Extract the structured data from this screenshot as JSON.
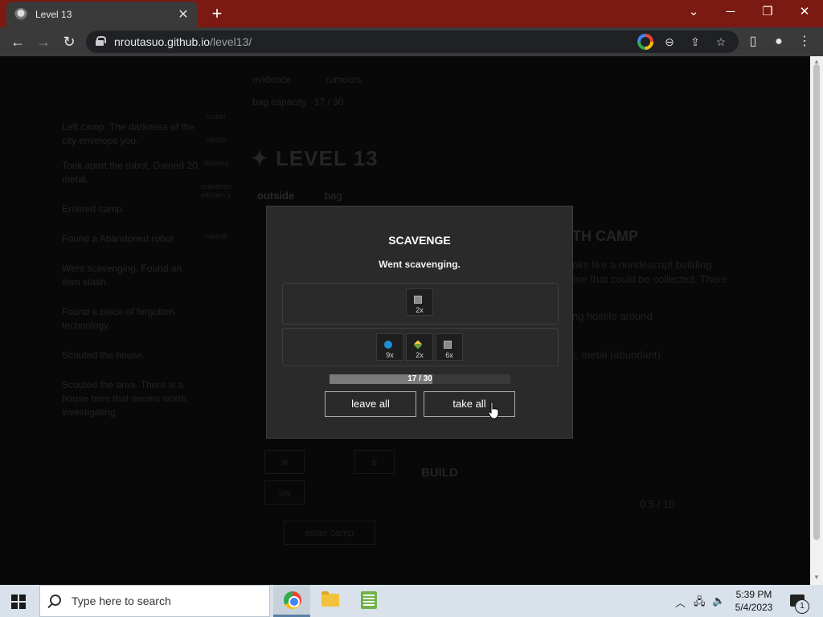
{
  "browser": {
    "tab_title": "Level 13",
    "tab_close": "✕",
    "new_tab": "+",
    "url_host": "nroutasuo.github.io",
    "url_path": "/level13/",
    "window_controls": {
      "minimize": "─",
      "restore": "❐",
      "close": "✕",
      "tabsearch": "⌄"
    }
  },
  "game": {
    "log": [
      {
        "ts": "",
        "msg": "Left camp. The darkness of the city envelops you."
      },
      {
        "ts": "",
        "msg": "Took apart the robot. Gained 20 metal."
      },
      {
        "ts": "",
        "msg": "Entered camp."
      },
      {
        "ts": "",
        "msg": "Found a Abandoned robot"
      },
      {
        "ts": "",
        "msg": "Went scavenging. Found an item stash."
      },
      {
        "ts": "",
        "msg": "Found a piece of forgotten technology."
      },
      {
        "ts": "",
        "msg": "Scouted the house."
      },
      {
        "ts": "",
        "msg": "Scouted the area. There is a house here that seems worth investigating."
      }
    ],
    "stats": [
      "vision",
      "health",
      "stamina",
      "scavenge efficiency",
      "warmth"
    ],
    "top_info": {
      "evidence": "evidence",
      "rumours": "rumours",
      "bag": "bag capacity",
      "bag_value": "17 / 30"
    },
    "level_heading": "LEVEL 13",
    "tabs": [
      "outside",
      "bag"
    ],
    "camp_heading": "TH CAMP",
    "bg_texts": [
      "oks like a nondescript building",
      "ere that could be collected. There",
      "ng hostile around",
      "), metal (abundant)",
      "BUILD",
      "0 5 / 10"
    ],
    "bg_buttons": [
      "w",
      "e",
      "sw",
      "enter camp"
    ]
  },
  "modal": {
    "title": "SCAVENGE",
    "subtitle": "Went scavenging.",
    "bag_items": [
      {
        "icon": "metal-icon",
        "qty": "2x"
      }
    ],
    "found_items": [
      {
        "icon": "water-icon",
        "qty": "9x"
      },
      {
        "icon": "food-icon",
        "qty": "2x"
      },
      {
        "icon": "metal-icon",
        "qty": "6x"
      }
    ],
    "capacity": {
      "label": "17 / 30",
      "value": 17,
      "max": 30
    },
    "leave_all": "leave all",
    "take_all": "take all"
  },
  "taskbar": {
    "search_placeholder": "Type here to search",
    "time": "5:39 PM",
    "date": "5/4/2023",
    "notification_count": "1"
  }
}
